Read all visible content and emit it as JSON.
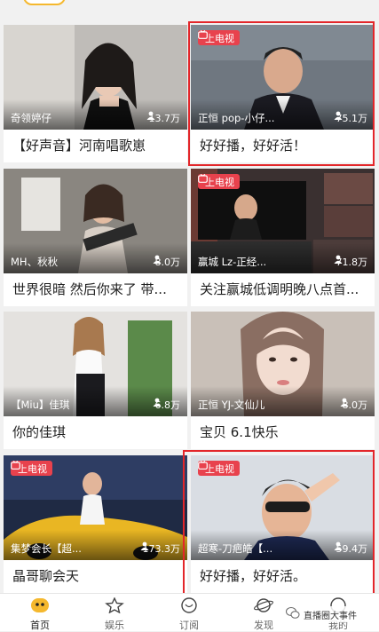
{
  "cards": [
    {
      "streamer": "奇领婷仔",
      "viewers": "13.7万",
      "title": "【好声音】河南唱歌崽",
      "badge": ""
    },
    {
      "streamer": "正恒 pop-小仔...",
      "viewers": "75.1万",
      "title": "好好播，好好活！",
      "badge": "上电视"
    },
    {
      "streamer": "MH、秋秋",
      "viewers": "8.0万",
      "title": "世界很暗 然后你来了 带...",
      "badge": ""
    },
    {
      "streamer": "赢城 Lz-正经...",
      "viewers": "71.8万",
      "title": "关注赢城低调明晚八点首...",
      "badge": "上电视"
    },
    {
      "streamer": "【Miu】佳琪",
      "viewers": "6.8万",
      "title": "你的佳琪",
      "badge": ""
    },
    {
      "streamer": "正恒 YJ-文仙儿",
      "viewers": "8.0万",
      "title": "宝贝 6.1快乐",
      "badge": ""
    },
    {
      "streamer": "集梦会长【超...",
      "viewers": "173.3万",
      "title": "晶哥聊会天",
      "badge": "上电视"
    },
    {
      "streamer": "超寒-刀疤皓【...",
      "viewers": "59.4万",
      "title": "好好播，好好活。",
      "badge": "上电视"
    }
  ],
  "nav": {
    "home": "首页",
    "entertainment": "娱乐",
    "subscribe": "订阅",
    "discover": "发现",
    "mine": "我的"
  },
  "watermark": "直播圈大事件",
  "colors": {
    "badge": "#e8424d",
    "highlight": "#e3262a",
    "accent": "#f5b82e"
  }
}
